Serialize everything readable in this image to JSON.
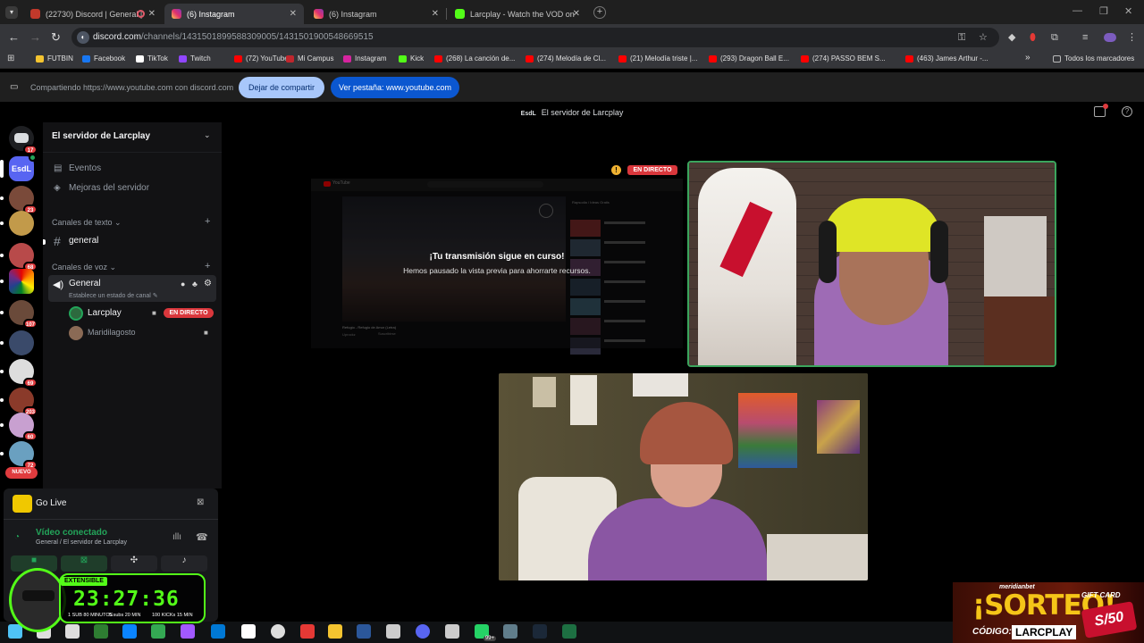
{
  "browser": {
    "tabs": [
      {
        "title": "(22730) Discord | General |",
        "active": false,
        "color": "#7289da"
      },
      {
        "title": "(6) Instagram",
        "active": true,
        "color": "#d6249f"
      },
      {
        "title": "(6) Instagram",
        "active": false,
        "color": "#d6249f"
      },
      {
        "title": "Larcplay - Watch the VOD on K",
        "active": false,
        "color": "#53fc18"
      }
    ],
    "url_domain": "discord.com",
    "url_path": "/channels/1431501899588309005/1431501900548669515",
    "bookmarks": [
      {
        "label": "FUTBIN",
        "color": "#f4c430"
      },
      {
        "label": "Facebook",
        "color": "#1877f2"
      },
      {
        "label": "TikTok",
        "color": "#ffffff"
      },
      {
        "label": "Twitch",
        "color": "#9146ff"
      },
      {
        "label": "(72) YouTube",
        "color": "#ff0000"
      },
      {
        "label": "Mi Campus",
        "color": "#c0262d"
      },
      {
        "label": "Instagram",
        "color": "#d6249f"
      },
      {
        "label": "Kick",
        "color": "#53fc18"
      },
      {
        "label": "(268) La canción de...",
        "color": "#ff0000"
      },
      {
        "label": "(274) Melodía de Cl...",
        "color": "#ff0000"
      },
      {
        "label": "(21) Melodía triste |...",
        "color": "#ff0000"
      },
      {
        "label": "(293) Dragon Ball E...",
        "color": "#ff0000"
      },
      {
        "label": "(274) PASSO BEM S...",
        "color": "#ff0000"
      },
      {
        "label": "(463) James Arthur -...",
        "color": "#ff0000"
      }
    ],
    "bookmarks_overflow": "»",
    "all_bookmarks": "Todos los marcadores"
  },
  "share_banner": {
    "text": "Compartiendo https://www.youtube.com con discord.com",
    "stop_button": "Dejar de compartir",
    "view_tab_button": "Ver pestaña: www.youtube.com"
  },
  "discord": {
    "header_title": "El servidor de Larcplay",
    "header_icon_text": "EsdL",
    "server_name": "El servidor de Larcplay",
    "dm_badge": "17",
    "new_badge": "NUEVO",
    "guild_badges": [
      "23",
      "68",
      "107",
      "69",
      "203",
      "60",
      "72"
    ],
    "nav": [
      {
        "label": "Eventos",
        "icon": "calendar-icon"
      },
      {
        "label": "Mejoras del servidor",
        "icon": "boost-icon"
      }
    ],
    "text_category": "Canales de texto",
    "text_channels": [
      "general"
    ],
    "voice_category": "Canales de voz",
    "voice_channel": {
      "name": "General",
      "status_placeholder": "Establece un estado de canal"
    },
    "voice_users": [
      {
        "name": "Larcplay",
        "live": true,
        "live_label": "EN DIRECTO"
      },
      {
        "name": "Maridilagosto",
        "live": false
      }
    ],
    "panel": {
      "go_live": "Go Live",
      "status": "Vídeo conectado",
      "location": "General / El servidor de Larcplay"
    },
    "stream": {
      "live_label": "EN DIRECTO",
      "paused_title": "¡Tu transmisión sigue en curso!",
      "paused_subtitle": "Hemos pausado la vista previa para ahorrarte recursos.",
      "preview_site_label": "YouTube",
      "preview_side_title": "Rapsodia / Ideas Gratis",
      "preview_video_title": "Refugio - Refugio de Amor (Letra)",
      "preview_channel": "Uprockz",
      "preview_uploader_label": "Suscribirse"
    }
  },
  "overlay": {
    "extensible_label": "EXTENSIBLE",
    "timer": "23:27:36",
    "stats": [
      "1 SUB 80 MINUTOS",
      "5 subs 20 MIN",
      "100 KICKs 15 MIN"
    ],
    "promo_brand": "meridianbet",
    "promo_title": "¡SORTEO!",
    "promo_code_label": "CÓDIGO:",
    "promo_code": "LARCPLAY",
    "gift_card_label": "GIFT CARD",
    "gift_amount": "S/50"
  },
  "taskbar": {
    "apps": [
      "windows-icon",
      "search-icon",
      "task-view-icon",
      "widgets-icon",
      "edge-icon",
      "chrome-icon",
      "figma-icon",
      "outlook-icon",
      "capcut-icon",
      "obs-icon",
      "anydesk-icon",
      "file-explorer-icon",
      "word-icon",
      "nexus-icon",
      "discord-icon",
      "gaming-icon",
      "whatsapp-icon",
      "calculator-icon",
      "steam-icon",
      "excel-icon"
    ],
    "whatsapp_badge": "99+"
  }
}
